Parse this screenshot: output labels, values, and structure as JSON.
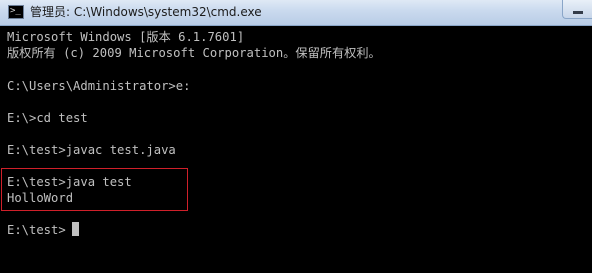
{
  "window": {
    "title": "管理员: C:\\Windows\\system32\\cmd.exe"
  },
  "console": {
    "lines": [
      "Microsoft Windows [版本 6.1.7601]",
      "版权所有 (c) 2009 Microsoft Corporation。保留所有权利。",
      "",
      "C:\\Users\\Administrator>e:",
      "",
      "E:\\>cd test",
      "",
      "E:\\test>javac test.java",
      "",
      "E:\\test>java test",
      "HolloWord",
      "",
      "E:\\test>"
    ]
  },
  "colors": {
    "console_background": "#000000",
    "console_text": "#c0c0c0",
    "highlight_border": "#d0202a",
    "titlebar": "#c9d9ee"
  },
  "icons": [
    "cmd-app-icon",
    "minimize-icon"
  ]
}
